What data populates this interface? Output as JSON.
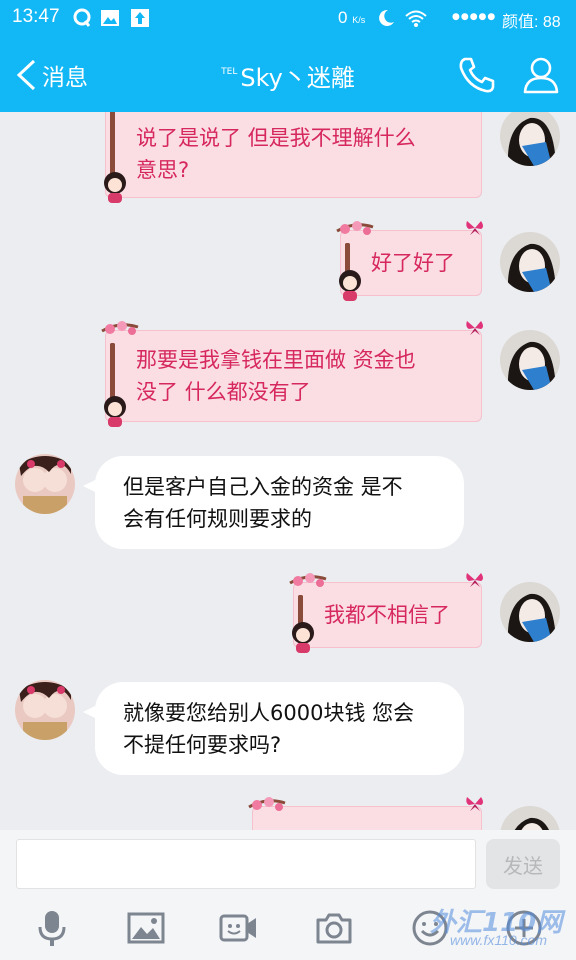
{
  "status_bar": {
    "time": "13:47",
    "net_speed": "0",
    "net_unit": "K/s",
    "signal": "●●●●●",
    "carrier": "颜值: 88"
  },
  "header": {
    "back_label": "消息",
    "title_prefix": "TEL",
    "title": "Sky丶迷離"
  },
  "messages": [
    {
      "side": "out",
      "lines": [
        "说了是说了  但是我不理解什么",
        "意思?"
      ]
    },
    {
      "side": "out",
      "lines": [
        "好了好了"
      ]
    },
    {
      "side": "out",
      "lines": [
        "那要是我拿钱在里面做 资金也",
        "没了 什么都没有了"
      ]
    },
    {
      "side": "in",
      "lines": [
        "但是客户自己入金的资金 是不",
        "会有任何规则要求的"
      ]
    },
    {
      "side": "out",
      "lines": [
        "我都不相信了"
      ]
    },
    {
      "side": "in",
      "lines": [
        "就像要您给别人6000块钱 您会",
        "不提任何要求吗?"
      ]
    }
  ],
  "input": {
    "value": "",
    "send_label": "发送"
  },
  "toolbar": [
    "voice-icon",
    "image-icon",
    "video-icon",
    "camera-icon",
    "emoji-icon",
    "plus-icon"
  ],
  "watermark": {
    "line1": "外汇110网",
    "line2": "www.fx110.com"
  },
  "colors": {
    "accent": "#12b7f5",
    "out_bubble": "#fbdde4",
    "out_text": "#d6285f",
    "in_bubble": "#ffffff"
  }
}
